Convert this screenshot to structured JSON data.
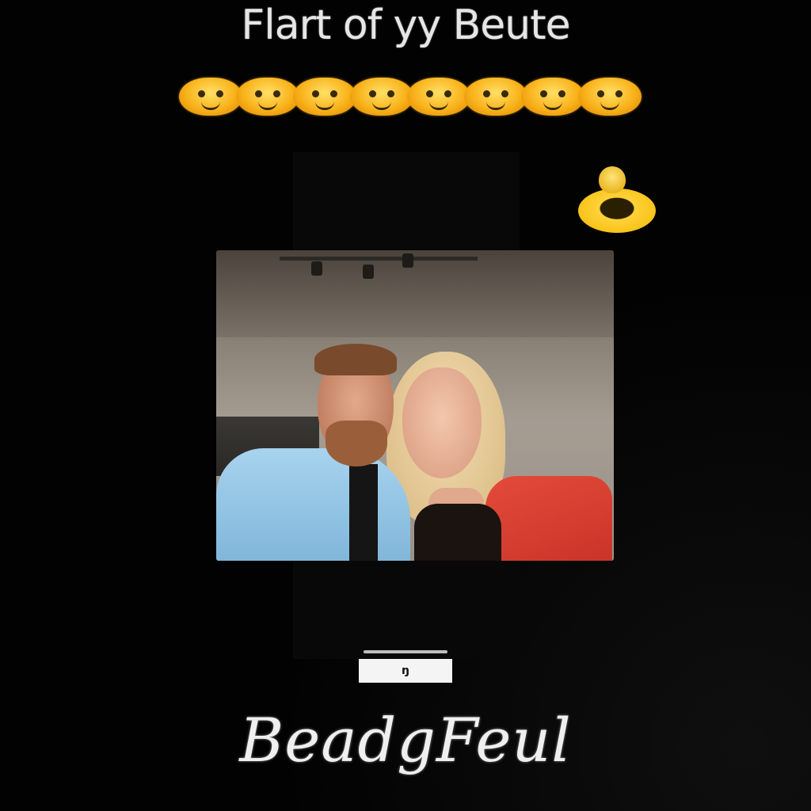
{
  "header": {
    "title": "Flart of yy Beute"
  },
  "decoration": {
    "emoji_row_icon": "smiley-face-icon",
    "emoji_count": 8,
    "badge_icon": "gold-trophy-icon",
    "accent_color": "#f9b21a"
  },
  "photo": {
    "alt": "Selfie of a smiling couple"
  },
  "caption": {
    "label": "ŋ"
  },
  "footer": {
    "signature": "BeadgFeul"
  }
}
